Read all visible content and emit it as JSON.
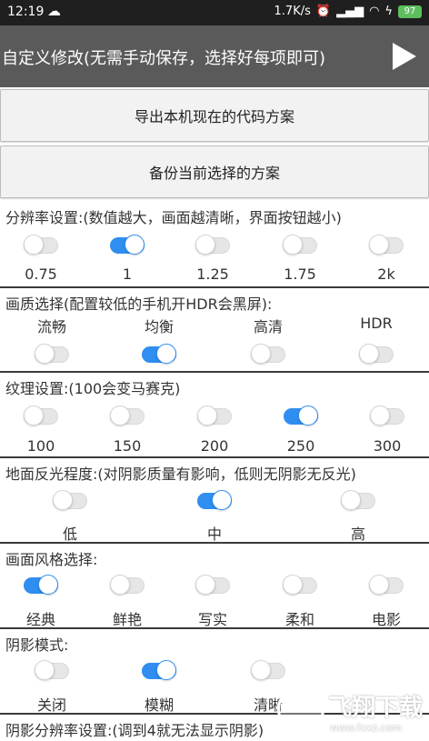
{
  "status_bar": {
    "time": "12:19",
    "speed": "1.7K/s",
    "battery": "97"
  },
  "app_bar": {
    "title": "自定义修改(无需手动保存，选择好每项即可)"
  },
  "buttons": {
    "export": "导出本机现在的代码方案",
    "backup": "备份当前选择的方案"
  },
  "sections": {
    "resolution": {
      "label": "分辨率设置:(数值越大，画面越清晰，界面按钮越小)",
      "options": [
        "0.75",
        "1",
        "1.25",
        "1.75",
        "2k"
      ],
      "selected": 1
    },
    "quality": {
      "label": "画质选择(配置较低的手机开HDR会黑屏):",
      "options": [
        "流畅",
        "均衡",
        "高清",
        "HDR"
      ],
      "selected": 1
    },
    "texture": {
      "label": "纹理设置:(100会变马赛克)",
      "options": [
        "100",
        "150",
        "200",
        "250",
        "300"
      ],
      "selected": 3
    },
    "reflection": {
      "label": "地面反光程度:(对阴影质量有影响，低则无阴影无反光)",
      "options": [
        "低",
        "中",
        "高"
      ],
      "selected": 1
    },
    "style": {
      "label": "画面风格选择:",
      "options": [
        "经典",
        "鲜艳",
        "写实",
        "柔和",
        "电影"
      ],
      "selected": 0
    },
    "shadow": {
      "label": "阴影模式:",
      "options": [
        "关闭",
        "模糊",
        "清晰"
      ],
      "selected": 1
    },
    "shadow_res": {
      "label": "阴影分辨率设置:(调到4就无法显示阴影)"
    }
  },
  "watermark": {
    "brand": "飞翔下载",
    "url": "www.fxxz.com"
  },
  "colors": {
    "accent": "#2f8ef0",
    "app_bar": "#5a5a5a",
    "status_bar": "#1f1f1f"
  }
}
